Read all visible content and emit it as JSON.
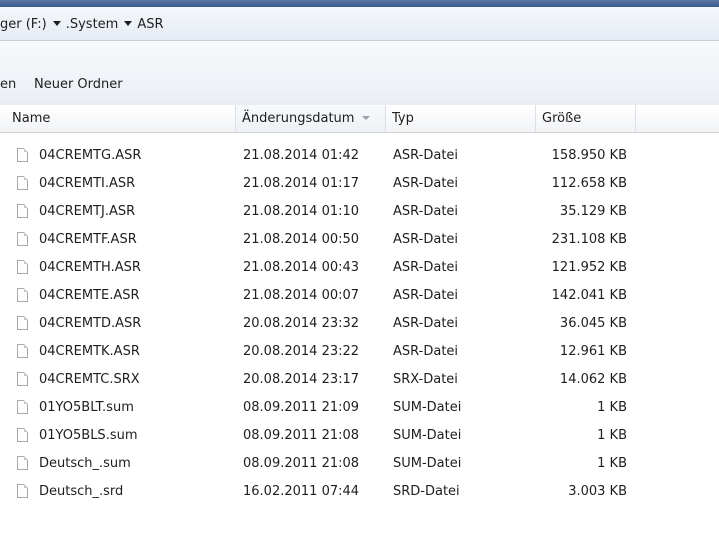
{
  "address": {
    "crumbs": [
      {
        "label": "ger (F:)"
      },
      {
        "label": ".System"
      },
      {
        "label": "ASR"
      }
    ]
  },
  "toolbar": {
    "partial_button_label": "en",
    "new_folder_label": "Neuer Ordner"
  },
  "columns": {
    "name": "Name",
    "date": "Änderungsdatum",
    "type": "Typ",
    "size": "Größe"
  },
  "files": [
    {
      "name": "04CREMTG.ASR",
      "date": "21.08.2014 01:42",
      "type": "ASR-Datei",
      "size": "158.950 KB"
    },
    {
      "name": "04CREMTI.ASR",
      "date": "21.08.2014 01:17",
      "type": "ASR-Datei",
      "size": "112.658 KB"
    },
    {
      "name": "04CREMTJ.ASR",
      "date": "21.08.2014 01:10",
      "type": "ASR-Datei",
      "size": "35.129 KB"
    },
    {
      "name": "04CREMTF.ASR",
      "date": "21.08.2014 00:50",
      "type": "ASR-Datei",
      "size": "231.108 KB"
    },
    {
      "name": "04CREMTH.ASR",
      "date": "21.08.2014 00:43",
      "type": "ASR-Datei",
      "size": "121.952 KB"
    },
    {
      "name": "04CREMTE.ASR",
      "date": "21.08.2014 00:07",
      "type": "ASR-Datei",
      "size": "142.041 KB"
    },
    {
      "name": "04CREMTD.ASR",
      "date": "20.08.2014 23:32",
      "type": "ASR-Datei",
      "size": "36.045 KB"
    },
    {
      "name": "04CREMTK.ASR",
      "date": "20.08.2014 23:22",
      "type": "ASR-Datei",
      "size": "12.961 KB"
    },
    {
      "name": "04CREMTC.SRX",
      "date": "20.08.2014 23:17",
      "type": "SRX-Datei",
      "size": "14.062 KB"
    },
    {
      "name": "01YO5BLT.sum",
      "date": "08.09.2011 21:09",
      "type": "SUM-Datei",
      "size": "1 KB"
    },
    {
      "name": "01YO5BLS.sum",
      "date": "08.09.2011 21:08",
      "type": "SUM-Datei",
      "size": "1 KB"
    },
    {
      "name": "Deutsch_.sum",
      "date": "08.09.2011 21:08",
      "type": "SUM-Datei",
      "size": "1 KB"
    },
    {
      "name": "Deutsch_.srd",
      "date": "16.02.2011 07:44",
      "type": "SRD-Datei",
      "size": "3.003 KB"
    }
  ]
}
